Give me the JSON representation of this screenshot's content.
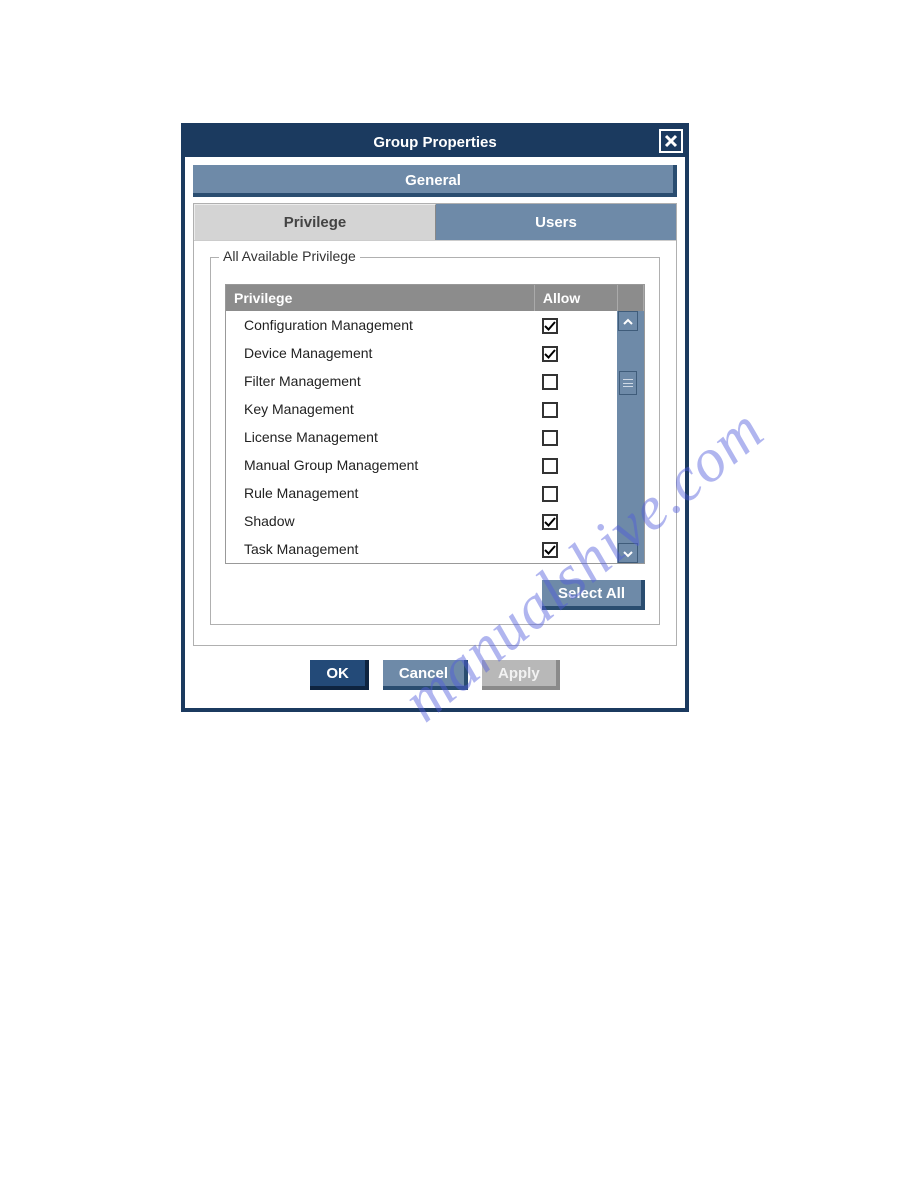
{
  "watermark_text": "manualshive.com",
  "dialog": {
    "title": "Group Properties",
    "general_button": "General",
    "tabs": {
      "privilege": "Privilege",
      "users": "Users"
    },
    "fieldset_legend": "All Available Privilege",
    "columns": {
      "privilege": "Privilege",
      "allow": "Allow"
    },
    "rows": [
      {
        "label": "Configuration Management",
        "allow": true
      },
      {
        "label": "Device Management",
        "allow": true
      },
      {
        "label": "Filter Management",
        "allow": false
      },
      {
        "label": "Key Management",
        "allow": false
      },
      {
        "label": "License Management",
        "allow": false
      },
      {
        "label": "Manual Group Management",
        "allow": false
      },
      {
        "label": "Rule Management",
        "allow": false
      },
      {
        "label": "Shadow",
        "allow": true
      },
      {
        "label": "Task Management",
        "allow": true
      }
    ],
    "select_all": "Select All",
    "buttons": {
      "ok": "OK",
      "cancel": "Cancel",
      "apply": "Apply"
    }
  }
}
